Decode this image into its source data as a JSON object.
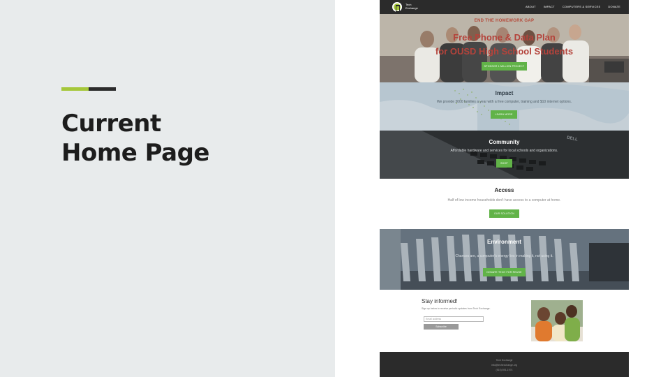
{
  "slide": {
    "title_line1": "Current",
    "title_line2": "Home Page",
    "accent_colors": [
      "#a5c73a",
      "#2b2b2b"
    ],
    "background": "#e8ebec"
  },
  "site": {
    "nav": {
      "logo_icon": "tech-exchange-logo-icon",
      "logo_line1": "Tech",
      "logo_line2": "Exchange",
      "links": [
        "ABOUT",
        "IMPACT",
        "COMPUTERS & SERVICES",
        "DONATE"
      ]
    },
    "hero": {
      "kicker": "END THE HOMEWORK GAP",
      "title_line1": "Free Phone & Data Plan",
      "title_line2": "for OUSD High School Students",
      "button": "SPONSOR 1 MILLION PROJECT"
    },
    "impact": {
      "title": "Impact",
      "text": "We provide 3000 families a year with a free computer, training and $10 internet options.",
      "button": "LEARN MORE"
    },
    "community": {
      "title": "Community",
      "text": "Affordable hardware and services for local schools and organizations.",
      "button": "SHOP",
      "laptop_brand": "DELL"
    },
    "access": {
      "title": "Access",
      "text": "Half of low income households don't have access to a computer at home.",
      "button": "OUR SOLUTION"
    },
    "environment": {
      "title": "Environment",
      "text": "Chances are, a computer's energy lies in making it, not using it.",
      "button": "DONATE TECH FOR REUSE"
    },
    "newsletter": {
      "title": "Stay informed!",
      "text": "Sign up below to receive periodic updates from Tech Exchange.",
      "email_placeholder": "Email address",
      "button": "Subscribe"
    },
    "footer": {
      "line1": "Tech Exchange",
      "line2": "info@techexchange.org",
      "line3": "(510) 891-1974"
    },
    "colors": {
      "nav": "#2b2b2b",
      "button_green": "#61b348",
      "hero_text": "#b4433b"
    }
  }
}
